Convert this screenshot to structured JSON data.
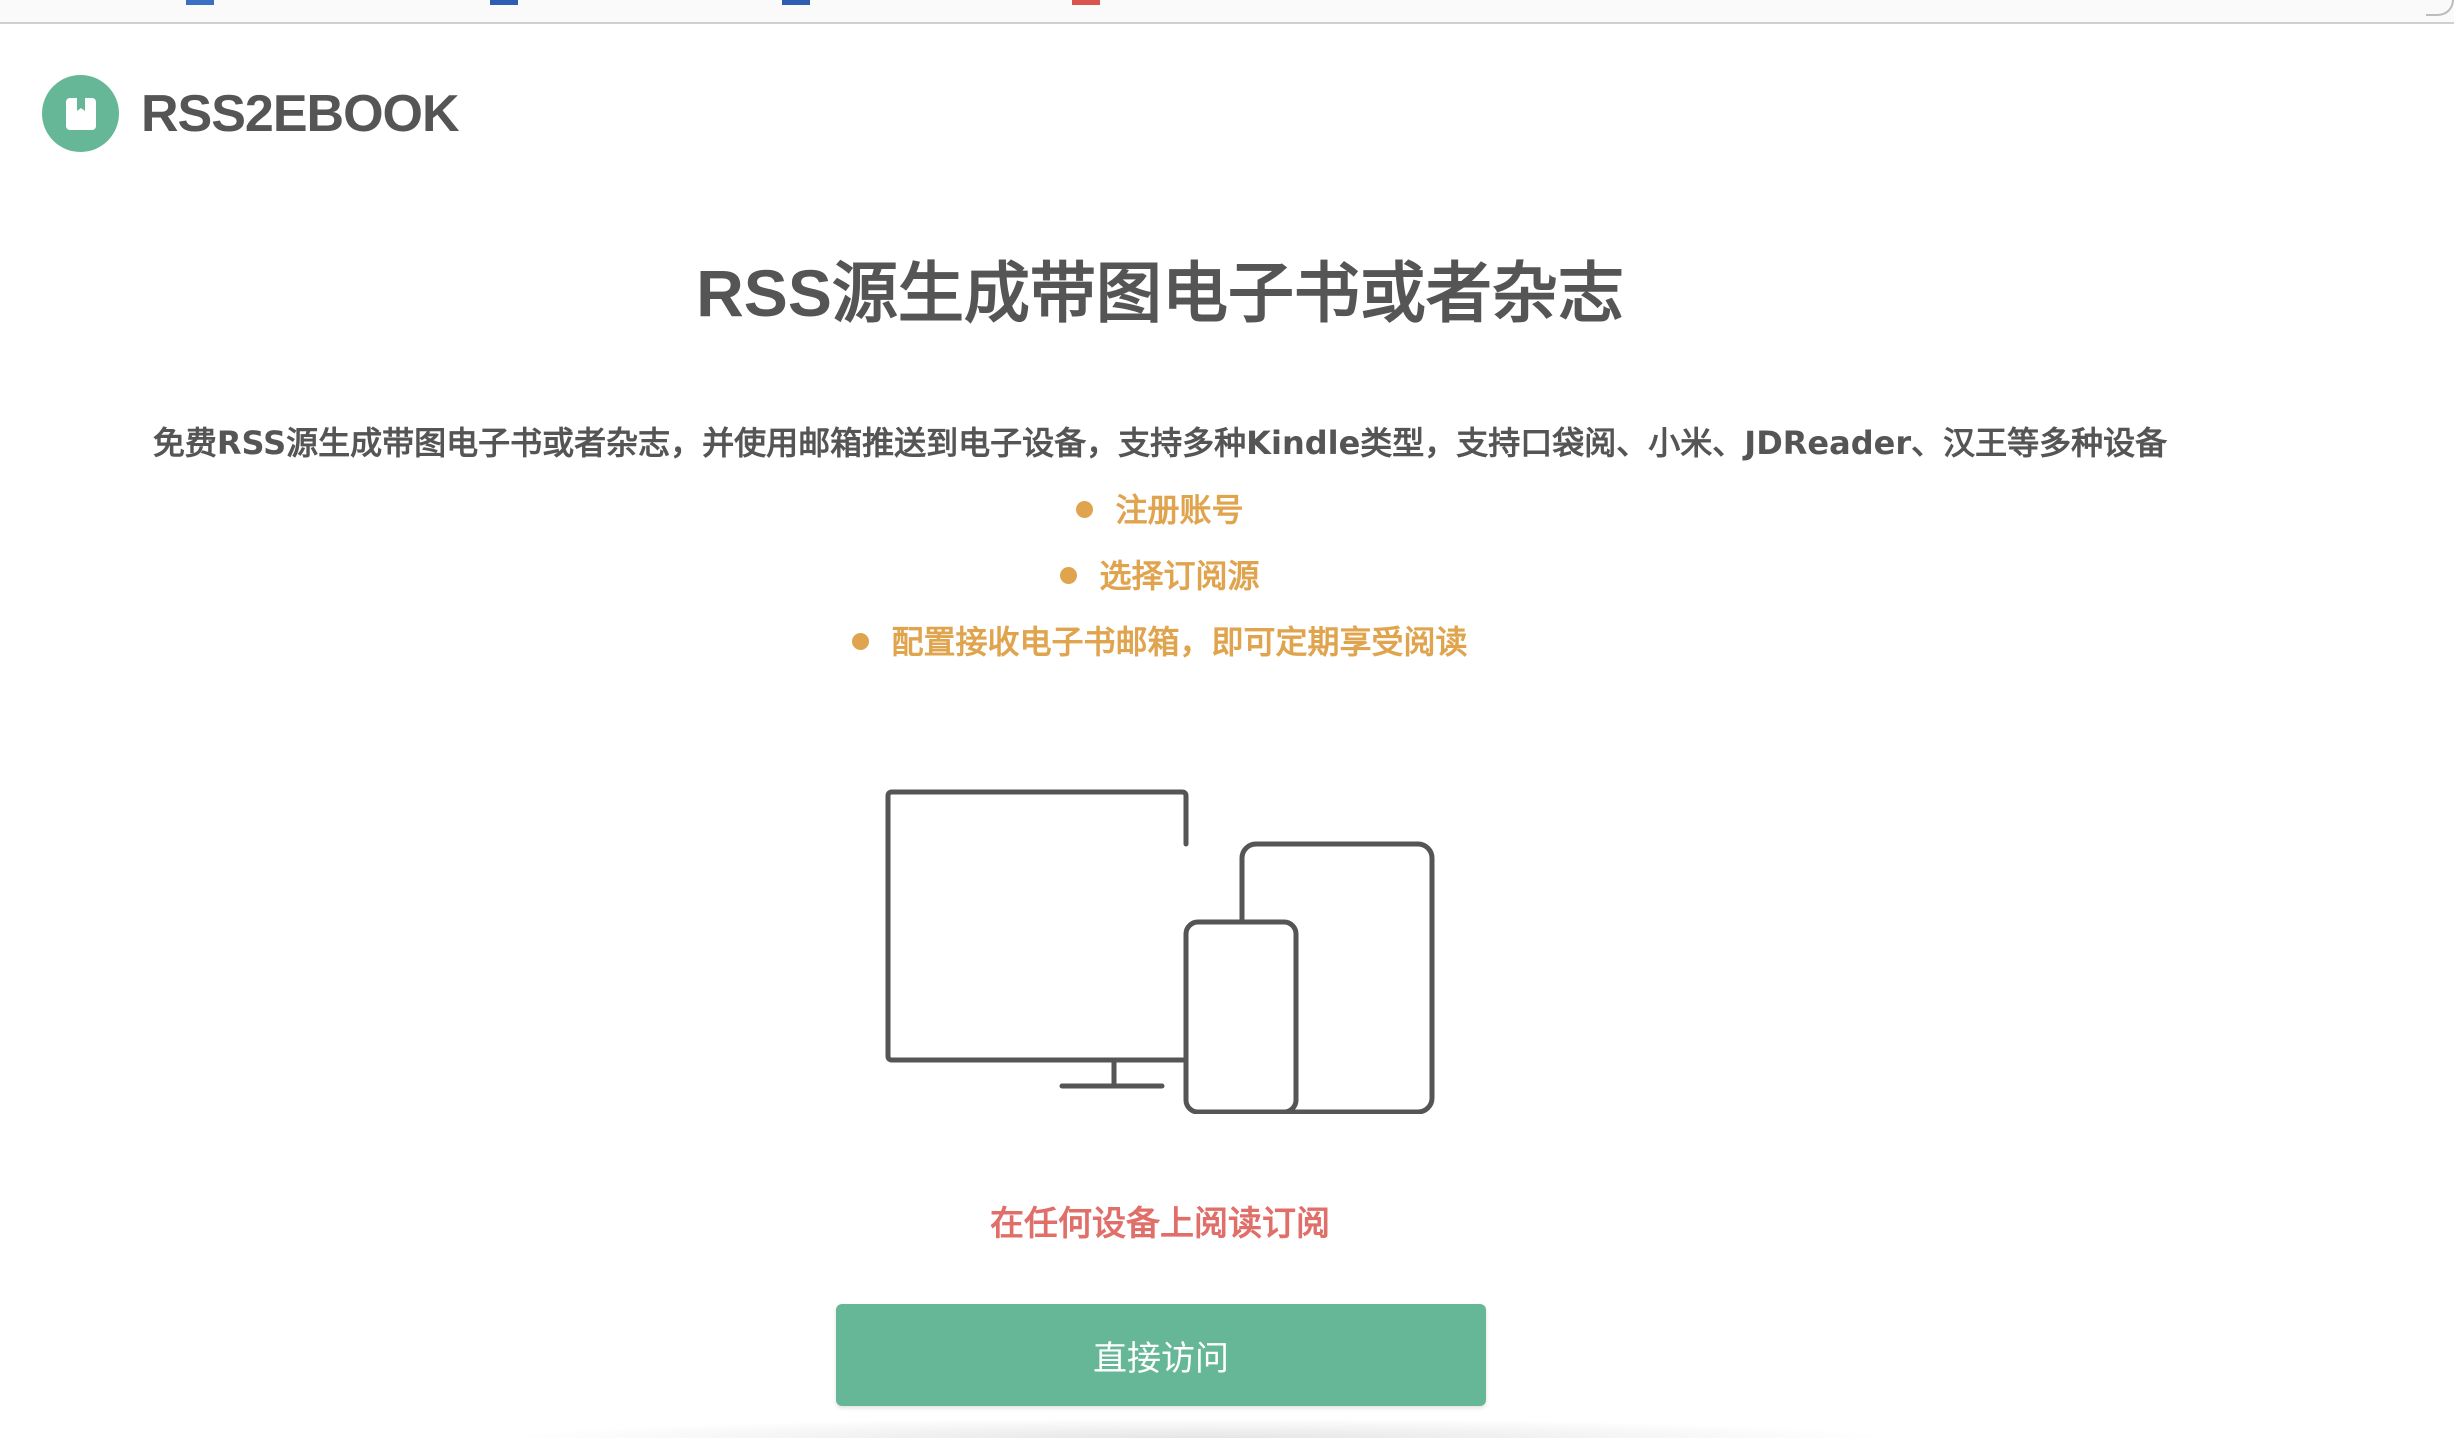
{
  "brand": {
    "name": "RSS2EBOOK",
    "color": "#66b798",
    "icon": "book-icon"
  },
  "hero": {
    "title": "RSS源生成带图电子书或者杂志",
    "description": "免费RSS源生成带图电子书或者杂志，并使用邮箱推送到电子设备，支持多种Kindle类型，支持口袋阅、小米、JDReader、汉王等多种设备"
  },
  "steps": [
    {
      "label": "注册账号"
    },
    {
      "label": "选择订阅源"
    },
    {
      "label": "配置接收电子书邮箱，即可定期享受阅读"
    }
  ],
  "illustration": {
    "icon": "devices-icon"
  },
  "caption": "在任何设备上阅读订阅",
  "cta": {
    "label": "直接访问"
  },
  "colors": {
    "step_accent": "#e0a44e",
    "caption": "#e06f6a",
    "text": "#555555"
  }
}
